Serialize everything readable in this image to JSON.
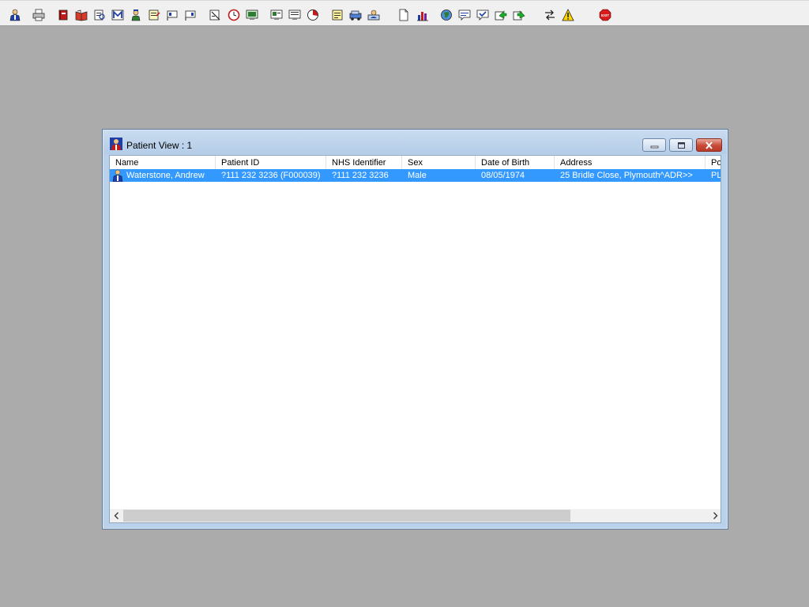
{
  "toolbar": {
    "buttons": [
      {
        "id": "patient",
        "icon": "patient-icon"
      },
      {
        "id": "print",
        "icon": "printer-icon"
      },
      {
        "id": "book",
        "icon": "book-icon"
      },
      {
        "id": "open-book",
        "icon": "open-book-icon"
      },
      {
        "id": "document-search",
        "icon": "document-search-icon"
      },
      {
        "id": "mail",
        "icon": "mail-m-icon"
      },
      {
        "id": "doctor",
        "icon": "doctor-icon"
      },
      {
        "id": "form",
        "icon": "form-icon"
      },
      {
        "id": "flag-1",
        "icon": "flag-icon"
      },
      {
        "id": "flag-2",
        "icon": "flag-icon"
      },
      {
        "id": "edit-document",
        "icon": "edit-document-icon"
      },
      {
        "id": "clock",
        "icon": "clock-icon"
      },
      {
        "id": "monitor",
        "icon": "monitor-icon"
      },
      {
        "id": "screen-1",
        "icon": "screen-icon"
      },
      {
        "id": "screen-2",
        "icon": "screen-icon"
      },
      {
        "id": "chart-circle",
        "icon": "chart-circle-icon"
      },
      {
        "id": "notes",
        "icon": "notes-icon"
      },
      {
        "id": "vehicle",
        "icon": "vehicle-icon"
      },
      {
        "id": "person-card",
        "icon": "person-card-icon"
      },
      {
        "id": "blank-page",
        "icon": "blank-page-icon"
      },
      {
        "id": "bar-chart",
        "icon": "bar-chart-icon"
      },
      {
        "id": "globe",
        "icon": "globe-icon"
      },
      {
        "id": "message-1",
        "icon": "message-icon"
      },
      {
        "id": "message-check",
        "icon": "message-check-icon"
      },
      {
        "id": "arrow-green-1",
        "icon": "green-arrow-icon"
      },
      {
        "id": "arrow-green-2",
        "icon": "green-arrow-icon"
      },
      {
        "id": "swap",
        "icon": "swap-icon"
      },
      {
        "id": "warning",
        "icon": "warning-icon"
      },
      {
        "id": "exit",
        "icon": "exit-icon",
        "label": "EXIT"
      }
    ]
  },
  "window": {
    "title": "Patient View : 1",
    "icon": "patient-icon"
  },
  "list": {
    "columns": [
      {
        "label": "Name"
      },
      {
        "label": "Patient ID"
      },
      {
        "label": "NHS Identifier"
      },
      {
        "label": "Sex"
      },
      {
        "label": "Date of Birth"
      },
      {
        "label": "Address"
      },
      {
        "label": "Po"
      }
    ],
    "rows": [
      {
        "selected": true,
        "icon": "patient-icon",
        "cells": [
          "Waterstone, Andrew",
          "?111 232 3236 (F000039)",
          "?111 232 3236",
          "Male",
          "08/05/1974",
          "25 Bridle Close, Plymouth^ADR>>",
          "PL"
        ]
      }
    ]
  },
  "colors": {
    "desktop": "#ababab",
    "selection": "#3399ff",
    "window_frame": "#b9d1ea",
    "close_button": "#c74a36"
  }
}
